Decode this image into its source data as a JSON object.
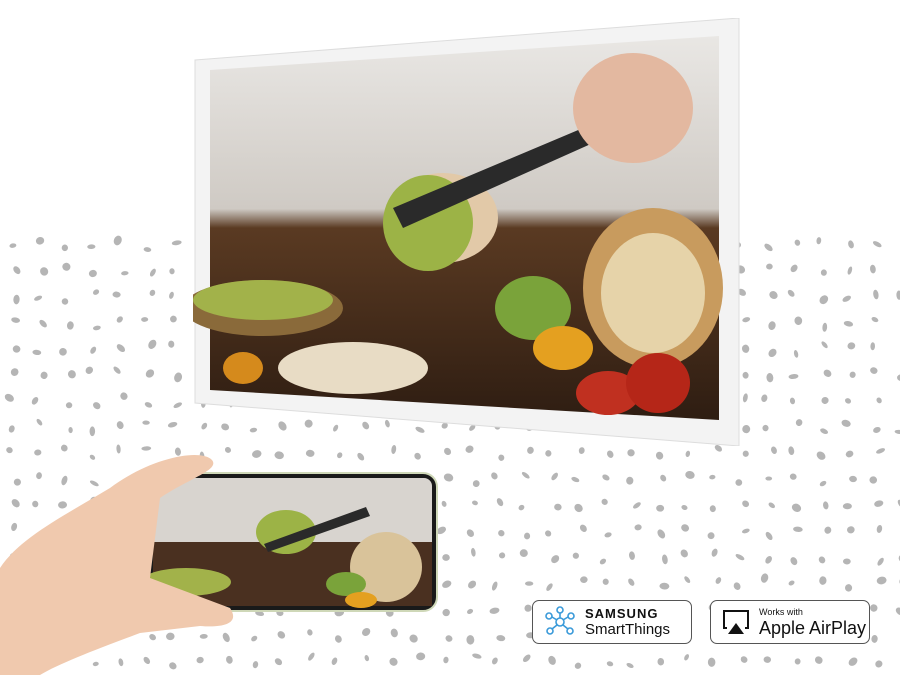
{
  "badges": {
    "smartthings": {
      "brand": "SAMSUNG",
      "product": "SmartThings",
      "icon": "smartthings-icon"
    },
    "airplay": {
      "prefix": "Works with",
      "product": "Apple AirPlay",
      "icon": "airplay-icon"
    }
  },
  "colors": {
    "dots": "#b5b5b5",
    "frame": "#f4f4f4",
    "smartthings_icon": "#3a9ad9"
  }
}
